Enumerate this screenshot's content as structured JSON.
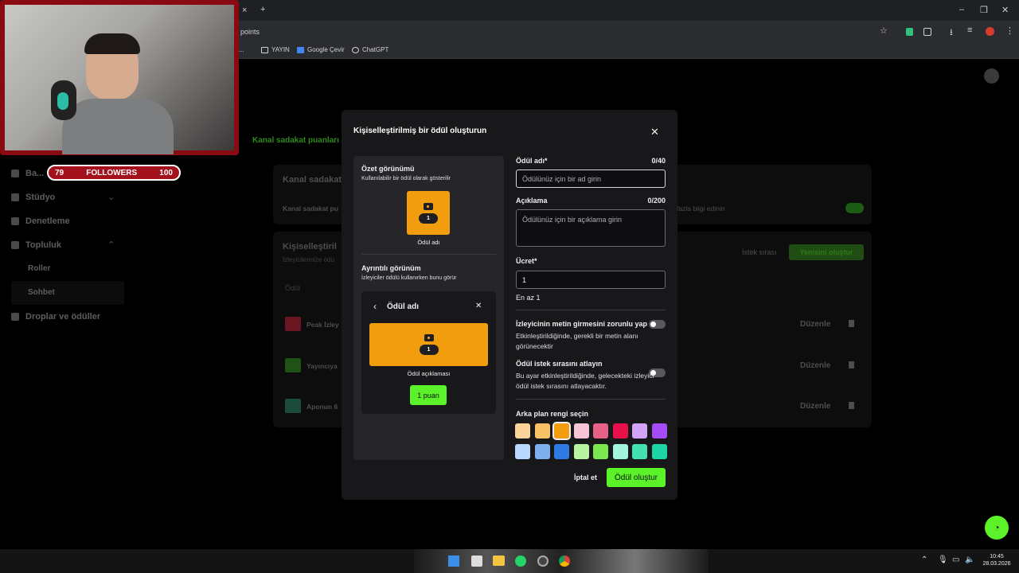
{
  "browser": {
    "url": "points",
    "new_tab": "+",
    "tab_close": "×",
    "bookmark_truncated": "Sa...",
    "bookmarks": [
      {
        "label": "YAYIN"
      },
      {
        "label": "Google Çevir"
      },
      {
        "label": "ChatGPT"
      }
    ],
    "win_min": "–",
    "win_max": "❐",
    "win_close": "✕"
  },
  "overlay": {
    "followers_current": "79",
    "followers_label": "FOLLOWERS",
    "followers_goal": "100"
  },
  "sidebar": {
    "items": [
      {
        "label": "Ba..."
      },
      {
        "label": "Stüdyo"
      },
      {
        "label": "Denetleme"
      },
      {
        "label": "Topluluk"
      }
    ],
    "subitems": [
      {
        "label": "Roller"
      },
      {
        "label": "Sohbet"
      }
    ],
    "drops_label": "Droplar ve ödüller"
  },
  "background_page": {
    "breadcrumb": "Kanal sadakat puanları",
    "card1_title": "Kanal sadakat",
    "card1_row": "Kanal sadakat pu",
    "more_info": "fazla bilgi edinin",
    "card2_title": "Kişiselleştiril",
    "card2_sub": "İzleyicilerinize ödü",
    "col_reward": "Ödül",
    "queue_label": "İstek sırası",
    "create_new": "Yenisini oluştur",
    "rows": [
      {
        "name": "Peak İzley",
        "action": "Düzenle"
      },
      {
        "name": "Yayıncıya",
        "action": "Düzenle"
      },
      {
        "name": "Aponun 6",
        "action": "Düzenle"
      }
    ]
  },
  "modal": {
    "title": "Kişiselleştirilmiş bir ödül oluşturun",
    "preview": {
      "summary_title": "Özet görünümü",
      "summary_sub": "Kullanılabilir bir ödül olarak gösterilir",
      "badge": "1",
      "reward_name": "Ödül adı",
      "detail_title": "Ayrıntılı görünüm",
      "detail_sub": "İzleyiciler ödülü kullanırken bunu görür",
      "detail_header": "Ödül adı",
      "detail_desc": "Ödül açıklaması",
      "points_btn": "1 puan"
    },
    "form": {
      "name_label": "Ödül adı*",
      "name_count": "0/40",
      "name_placeholder": "Ödülünüz için bir ad girin",
      "desc_label": "Açıklama",
      "desc_count": "0/200",
      "desc_placeholder": "Ödülünüz için bir açıklama girin",
      "cost_label": "Ücret*",
      "cost_value": "1",
      "cost_hint": "En az 1",
      "require_text_label": "İzleyicinin metin girmesini zorunlu yap",
      "require_text_desc": "Etkinleştirildiğinde, gerekli bir metin alanı görünecektir",
      "skip_queue_label": "Ödül istek sırasını atlayın",
      "skip_queue_desc": "Bu ayar etkinleştirildiğinde, gelecekteki izleyici ödül istek sırasını atlayacaktır.",
      "bg_color_label": "Arka plan rengi seçin",
      "colors_row1": [
        "#fbd49a",
        "#fac265",
        "#f29d0d",
        "#f8c5d6",
        "#e66188",
        "#e8104a",
        "#d3a3f8",
        "#a64cf7"
      ],
      "colors_row2": [
        "#bad7fd",
        "#7cb0ef",
        "#2f7be6",
        "#b9f5a0",
        "#7ce84f",
        "#a1f4dd",
        "#45e0b2",
        "#1cd4a4"
      ],
      "selected_color": "#f29d0d"
    },
    "cancel": "İptal et",
    "submit": "Ödül oluştur"
  },
  "taskbar": {
    "time": "10:45",
    "date": "28.03.2026"
  },
  "colors": {
    "accent_green": "#5cf22a",
    "reward_orange": "#f29d0d"
  }
}
